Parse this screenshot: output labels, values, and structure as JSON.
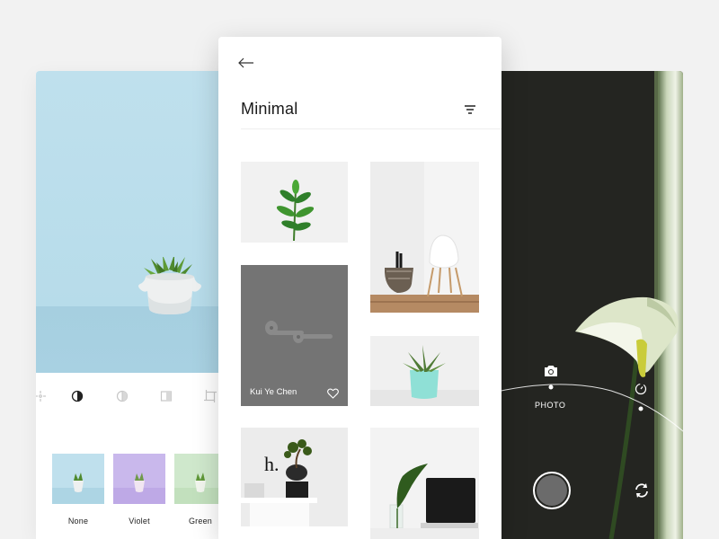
{
  "editor": {
    "tools": [
      {
        "icon": "sparkle-icon",
        "active": false
      },
      {
        "icon": "contrast-icon",
        "active": true
      },
      {
        "icon": "half-circle-icon",
        "active": false
      },
      {
        "icon": "split-icon",
        "active": false
      },
      {
        "icon": "crop-icon",
        "active": false
      }
    ],
    "filters": [
      {
        "label": "None",
        "tint": "#bfe0ed"
      },
      {
        "label": "Violet",
        "tint": "#c9b8ec"
      },
      {
        "label": "Green",
        "tint": "#cfe8cc"
      }
    ]
  },
  "gallery": {
    "title": "Minimal",
    "photo_credit": "Kui Ye Chen",
    "liked": false
  },
  "camera": {
    "mode_label": "PHOTO"
  },
  "colors": {
    "background": "#f2f2f2",
    "camera_dark": "#242521",
    "overlay_gray": "#747474"
  }
}
